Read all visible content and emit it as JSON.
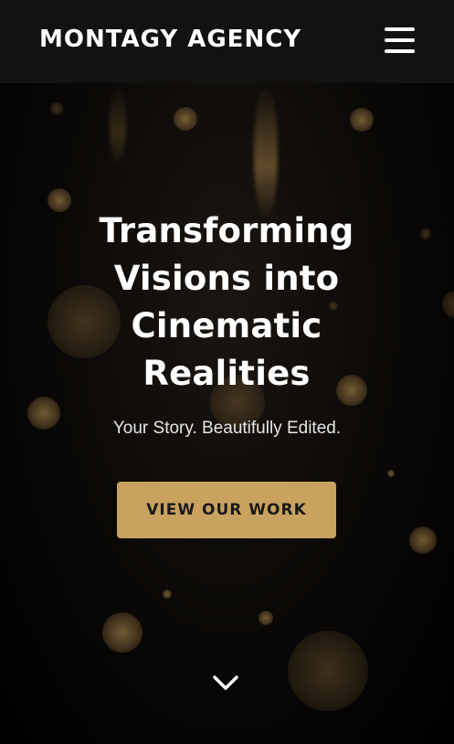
{
  "header": {
    "brand": "MONTAGY AGENCY",
    "menu_icon": "hamburger-menu-icon"
  },
  "hero": {
    "title": "Transforming Visions into Cinematic Realities",
    "subtitle": "Your Story. Beautifully Edited.",
    "cta_label": "VIEW OUR WORK",
    "scroll_icon": "chevron-down-icon"
  },
  "colors": {
    "accent": "#c9a25f",
    "header_bg": "#141414",
    "background": "#000000",
    "text": "#ffffff"
  }
}
